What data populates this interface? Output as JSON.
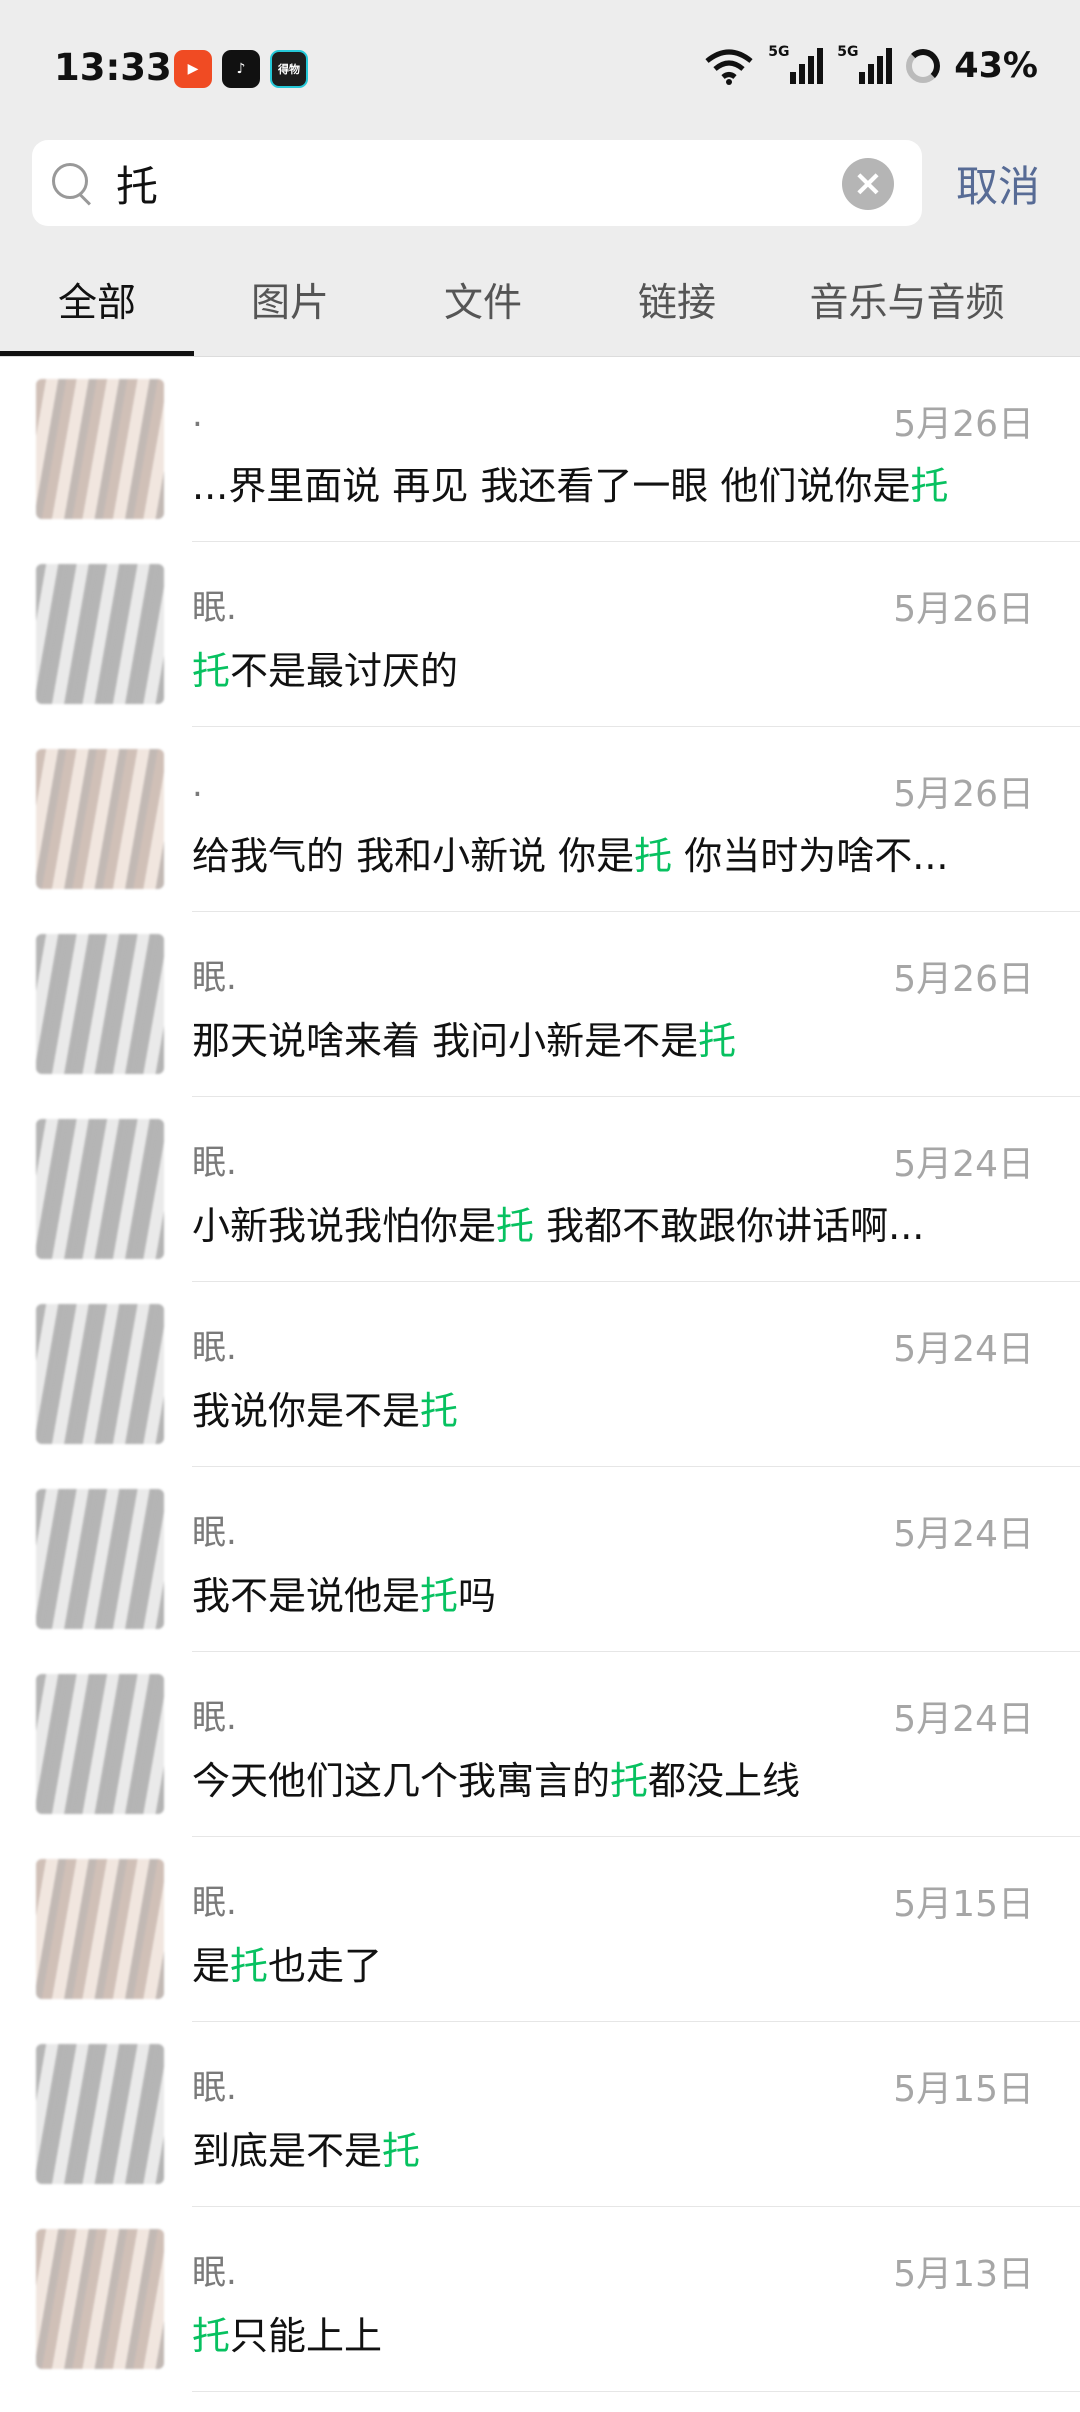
{
  "status_bar": {
    "time": "13:33",
    "app_icons": [
      {
        "name": "video-app-icon",
        "glyph": "▶",
        "color": "#f04b23"
      },
      {
        "name": "tiktok-icon",
        "glyph": "♪",
        "color": "#111111"
      },
      {
        "name": "dewu-app-icon",
        "glyph": "得物",
        "color": "#1d1d1d"
      }
    ],
    "signal1_label": "5G",
    "signal2_label": "5G",
    "battery_percent": "43%"
  },
  "search": {
    "query": "托",
    "clear_icon": "×",
    "cancel_label": "取消"
  },
  "tabs": [
    {
      "label": "全部",
      "active": true
    },
    {
      "label": "图片",
      "active": false
    },
    {
      "label": "文件",
      "active": false
    },
    {
      "label": "链接",
      "active": false
    },
    {
      "label": "音乐与音频",
      "active": false
    }
  ],
  "highlight_color": "#07c160",
  "results": [
    {
      "name": ".",
      "date": "5月26日",
      "pre": "...界里面说 再见 我还看了一眼 他们说你是",
      "hl": "托",
      "post": ""
    },
    {
      "name": "眠.",
      "date": "5月26日",
      "pre": "",
      "hl": "托",
      "post": "不是最讨厌的"
    },
    {
      "name": ".",
      "date": "5月26日",
      "pre": "给我气的 我和小新说 你是",
      "hl": "托",
      "post": " 你当时为啥不..."
    },
    {
      "name": "眠.",
      "date": "5月26日",
      "pre": "那天说啥来着 我问小新是不是",
      "hl": "托",
      "post": ""
    },
    {
      "name": "眠.",
      "date": "5月24日",
      "pre": "小新我说我怕你是",
      "hl": "托",
      "post": " 我都不敢跟你讲话啊..."
    },
    {
      "name": "眠.",
      "date": "5月24日",
      "pre": "我说你是不是",
      "hl": "托",
      "post": ""
    },
    {
      "name": "眠.",
      "date": "5月24日",
      "pre": "我不是说他是",
      "hl": "托",
      "post": "吗"
    },
    {
      "name": "眠.",
      "date": "5月24日",
      "pre": "今天他们这几个我寓言的",
      "hl": "托",
      "post": "都没上线"
    },
    {
      "name": "眠.",
      "date": "5月15日",
      "pre": "是",
      "hl": "托",
      "post": "也走了"
    },
    {
      "name": "眠.",
      "date": "5月15日",
      "pre": "到底是不是",
      "hl": "托",
      "post": ""
    },
    {
      "name": "眠.",
      "date": "5月13日",
      "pre": "",
      "hl": "托",
      "post": "只能上上"
    }
  ]
}
